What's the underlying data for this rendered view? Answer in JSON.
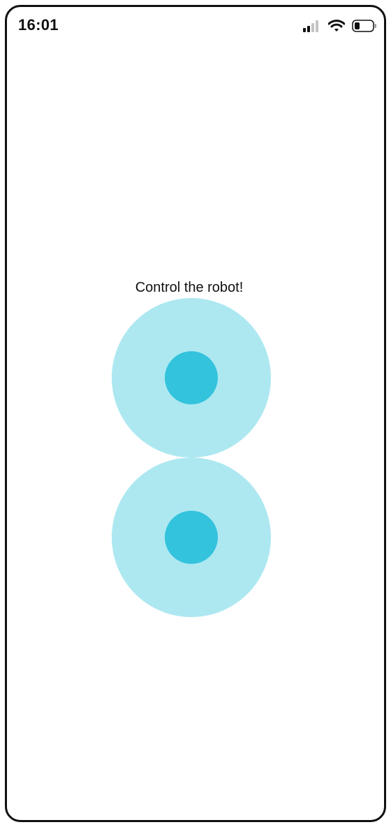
{
  "status_bar": {
    "time": "16:01",
    "icons": [
      "cellular-signal-icon",
      "wifi-icon",
      "battery-icon"
    ]
  },
  "screen": {
    "headline": "Control the robot!"
  },
  "joysticks": [
    {
      "name": "top-joystick"
    },
    {
      "name": "bottom-joystick"
    }
  ],
  "colors": {
    "joystick_base": "#ade8f1",
    "joystick_knob": "#33c3dd",
    "text": "#111111",
    "background": "#ffffff"
  }
}
